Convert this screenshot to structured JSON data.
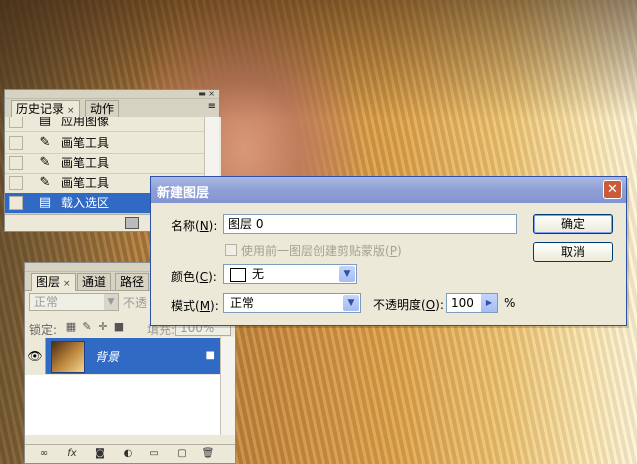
{
  "history_panel": {
    "tabs": [
      {
        "label": "历史记录"
      },
      {
        "label": "动作"
      }
    ],
    "items": [
      {
        "label": "应用图像",
        "icon": "document-icon",
        "selected": false
      },
      {
        "label": "画笔工具",
        "icon": "brush-icon",
        "selected": false
      },
      {
        "label": "画笔工具",
        "icon": "brush-icon",
        "selected": false
      },
      {
        "label": "画笔工具",
        "icon": "brush-icon",
        "selected": false
      },
      {
        "label": "载入选区",
        "icon": "document-icon",
        "selected": true
      }
    ]
  },
  "layers_panel": {
    "tabs": [
      {
        "label": "图层"
      },
      {
        "label": "通道"
      },
      {
        "label": "路径"
      }
    ],
    "blend_mode": "正常",
    "opacity_label": "不透",
    "lock_label": "锁定:",
    "fill_label": "填充:",
    "fill_value": "100%",
    "layer": {
      "name": "背景"
    }
  },
  "dialog": {
    "title": "新建图层",
    "name_label": "名称(",
    "name_key": "N",
    "name_label_end": "):",
    "name_value": "图层 0",
    "clip_checkbox_label": "使用前一图层创建剪贴蒙版(",
    "clip_key": "P",
    "clip_end": ")",
    "color_label": "颜色(",
    "color_key": "C",
    "color_end": "):",
    "color_value": "无",
    "mode_label": "模式(",
    "mode_key": "M",
    "mode_end": "):",
    "mode_value": "正常",
    "opacity_label": "不透明度(",
    "opacity_key": "O",
    "opacity_end": "):",
    "opacity_value": "100",
    "opacity_unit": "%",
    "ok_label": "确定",
    "cancel_label": "取消"
  },
  "colors": {
    "selection": "#316ac5",
    "dialog_title": "#8f9fd6",
    "panel_bg": "#ece9d8"
  }
}
